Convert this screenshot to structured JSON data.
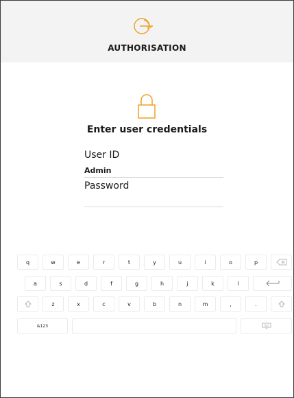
{
  "header": {
    "title": "AUTHORISATION",
    "icon": "key-icon",
    "accent_color": "#f0a023",
    "background": "#f3f3f3"
  },
  "login": {
    "icon": "lock-icon",
    "heading": "Enter user credentials",
    "user_id_label": "User ID",
    "user_id_value": "Admin",
    "password_label": "Password",
    "password_value": ""
  },
  "keyboard": {
    "row1": [
      "q",
      "w",
      "e",
      "r",
      "t",
      "y",
      "u",
      "i",
      "o",
      "p"
    ],
    "row2": [
      "a",
      "s",
      "d",
      "f",
      "g",
      "h",
      "j",
      "k",
      "l"
    ],
    "row3": [
      "z",
      "x",
      "c",
      "v",
      "b",
      "n",
      "m",
      ",",
      "."
    ],
    "symbols_label": "&123",
    "backspace_icon": "backspace-icon",
    "enter_icon": "enter-arrow-icon",
    "shift_icon": "shift-arrow-icon",
    "hide_keyboard_icon": "keyboard-icon"
  }
}
